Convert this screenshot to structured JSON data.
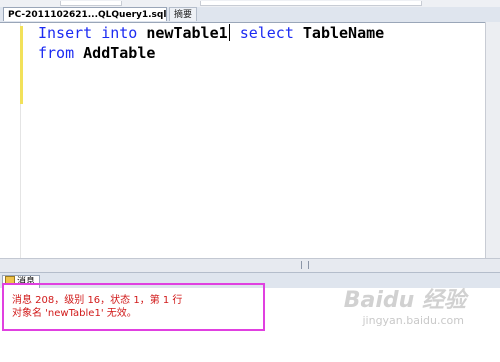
{
  "tabs": {
    "active_label": "PC-2011102621...QLQuery1.sql*",
    "second_label": "摘要"
  },
  "editor": {
    "line1": {
      "kw_insert": "Insert",
      "kw_into": "into",
      "table": "newTable1",
      "kw_select": "select",
      "column": "TableName"
    },
    "line2": {
      "kw_from": "from",
      "table": "AddTable"
    }
  },
  "results": {
    "tab_label": "消息",
    "messages": [
      "消息 208，级别 16，状态 1，第 1 行",
      "对象名 'newTable1' 无效。"
    ]
  },
  "watermark": {
    "brand": "Baidu 经验",
    "url": "jingyan.baidu.com"
  },
  "colors": {
    "keyword": "#1c2bf2",
    "error_text": "#d11a1a",
    "highlight_box": "#e040e0",
    "change_bar": "#f2e15a"
  }
}
